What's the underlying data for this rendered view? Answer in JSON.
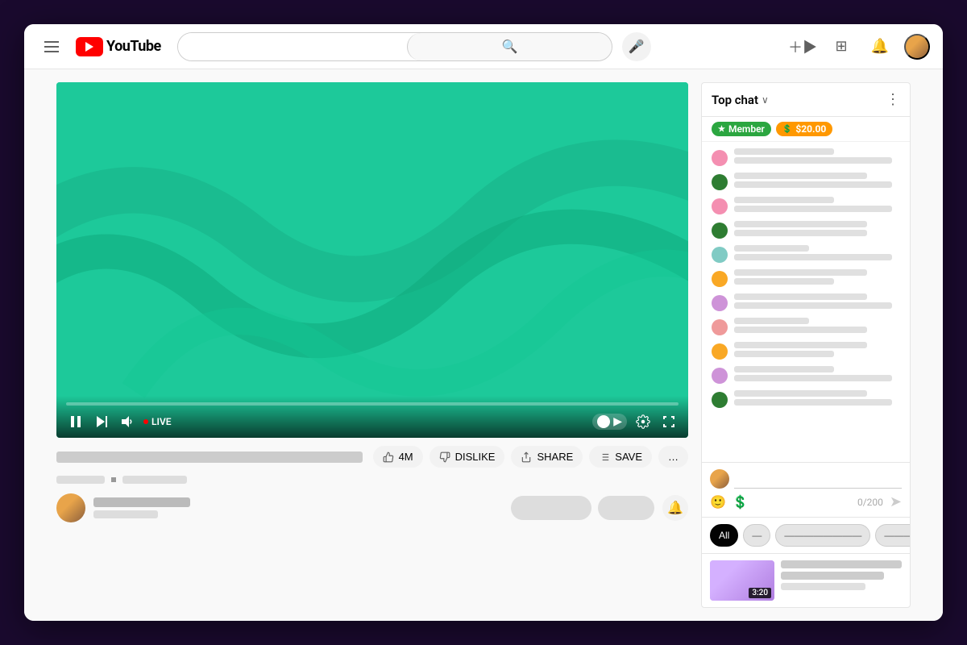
{
  "header": {
    "menu_icon": "☰",
    "logo_text": "YouTube",
    "search_placeholder": "",
    "search_icon": "🔍",
    "mic_icon": "🎤",
    "create_icon": "＋",
    "apps_icon": "⊞",
    "bell_icon": "🔔"
  },
  "video": {
    "live_label": "LIVE",
    "progress_percent": 0
  },
  "actions": {
    "like_count": "4M",
    "like_label": "LIKE",
    "dislike_label": "DISLIKE",
    "share_label": "SHARE",
    "save_label": "SAVE",
    "more_label": "…"
  },
  "chat": {
    "title": "Top chat",
    "chevron": "∨",
    "more_icon": "⋮",
    "badge_member": "Member",
    "badge_dollar": "$20.00",
    "messages": [
      {
        "color": "#f48fb1",
        "lines": [
          "short",
          "long"
        ]
      },
      {
        "color": "#2e7d32",
        "lines": [
          "medium",
          "long"
        ]
      },
      {
        "color": "#f48fb1",
        "lines": [
          "short",
          "long"
        ]
      },
      {
        "color": "#2e7d32",
        "lines": [
          "medium",
          "medium"
        ]
      },
      {
        "color": "#80cbc4",
        "lines": [
          "xshort",
          "long"
        ]
      },
      {
        "color": "#f9a825",
        "lines": [
          "medium",
          "short"
        ]
      },
      {
        "color": "#ce93d8",
        "lines": [
          "medium",
          "long"
        ]
      },
      {
        "color": "#ef9a9a",
        "lines": [
          "xshort",
          "medium"
        ]
      },
      {
        "color": "#f9a825",
        "lines": [
          "medium",
          "short"
        ]
      },
      {
        "color": "#ce93d8",
        "lines": [
          "short",
          "long"
        ]
      },
      {
        "color": "#2e7d32",
        "lines": [
          "medium",
          "long"
        ]
      }
    ],
    "input_placeholder": "",
    "char_count": "0/200",
    "filters": [
      {
        "label": "All",
        "active": true
      },
      {
        "label": "—",
        "active": false
      },
      {
        "label": "————————",
        "active": false
      },
      {
        "label": "———",
        "active": false
      }
    ],
    "rec_duration": "3:20"
  }
}
